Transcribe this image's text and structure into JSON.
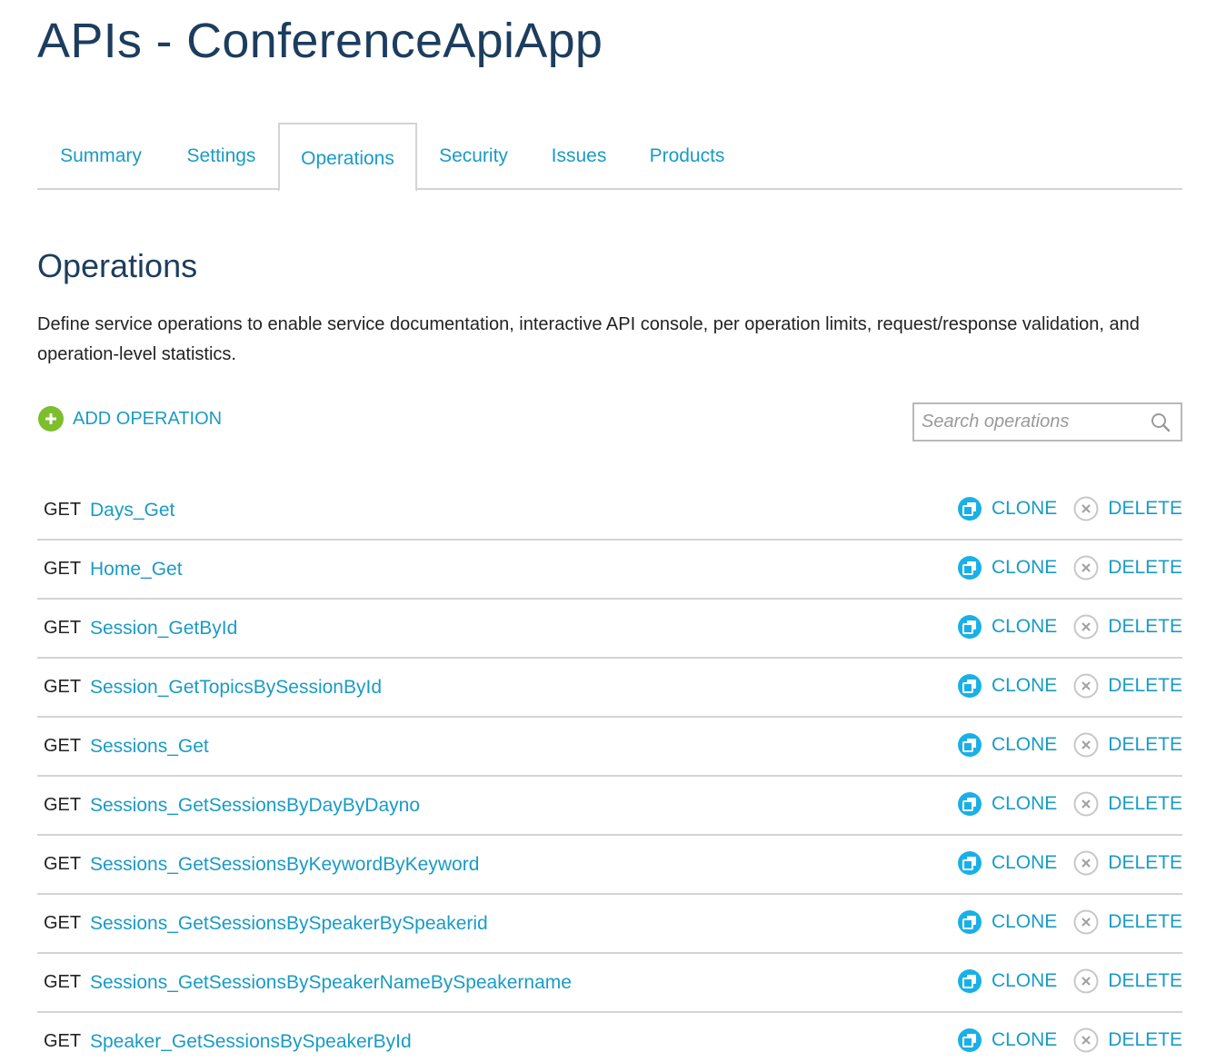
{
  "page": {
    "title": "APIs - ConferenceApiApp"
  },
  "tabs": [
    {
      "label": "Summary",
      "active": false
    },
    {
      "label": "Settings",
      "active": false
    },
    {
      "label": "Operations",
      "active": true
    },
    {
      "label": "Security",
      "active": false
    },
    {
      "label": "Issues",
      "active": false
    },
    {
      "label": "Products",
      "active": false
    }
  ],
  "section": {
    "title": "Operations",
    "description": "Define service operations to enable service documentation, interactive API console, per operation limits, request/response validation, and operation-level statistics."
  },
  "toolbar": {
    "add_label": "ADD OPERATION",
    "search_placeholder": "Search operations",
    "search_value": ""
  },
  "actions": {
    "clone_label": "CLONE",
    "delete_label": "DELETE"
  },
  "operations": [
    {
      "method": "GET",
      "name": "Days_Get"
    },
    {
      "method": "GET",
      "name": "Home_Get"
    },
    {
      "method": "GET",
      "name": "Session_GetById"
    },
    {
      "method": "GET",
      "name": "Session_GetTopicsBySessionById"
    },
    {
      "method": "GET",
      "name": "Sessions_Get"
    },
    {
      "method": "GET",
      "name": "Sessions_GetSessionsByDayByDayno"
    },
    {
      "method": "GET",
      "name": "Sessions_GetSessionsByKeywordByKeyword"
    },
    {
      "method": "GET",
      "name": "Sessions_GetSessionsBySpeakerBySpeakerid"
    },
    {
      "method": "GET",
      "name": "Sessions_GetSessionsBySpeakerNameBySpeakername"
    },
    {
      "method": "GET",
      "name": "Speaker_GetSessionsBySpeakerById"
    }
  ],
  "icons": {
    "add": "plus-circle-icon",
    "search": "search-icon",
    "clone": "clone-icon",
    "delete": "close-circle-icon"
  },
  "colors": {
    "link": "#1a9bc5",
    "title": "#1c3d5e",
    "add_green": "#7cbe2c",
    "clone_blue": "#1ab0e6",
    "border": "#d4d4d4"
  }
}
